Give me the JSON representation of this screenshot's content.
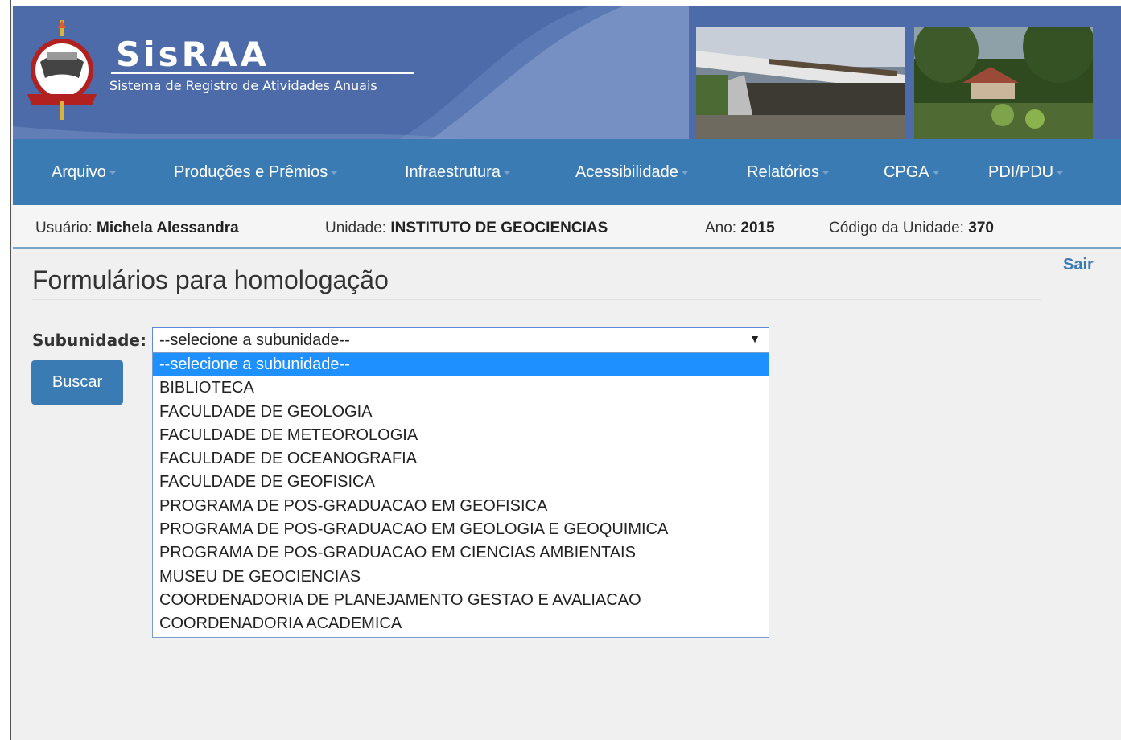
{
  "brand": {
    "title": "SisRAA",
    "subtitle": "Sistema de Registro de Atividades Anuais"
  },
  "nav": [
    {
      "label": "Arquivo"
    },
    {
      "label": "Produções e Prêmios"
    },
    {
      "label": "Infraestrutura"
    },
    {
      "label": "Acessibilidade"
    },
    {
      "label": "Relatórios"
    },
    {
      "label": "CPGA"
    },
    {
      "label": "PDI/PDU"
    }
  ],
  "info": {
    "user_label": "Usuário:",
    "user_value": "Michela Alessandra",
    "unit_label": "Unidade:",
    "unit_value": "INSTITUTO DE GEOCIENCIAS",
    "year_label": "Ano:",
    "year_value": "2015",
    "code_label": "Código da Unidade:",
    "code_value": "370"
  },
  "logout_label": "Sair",
  "page_title": "Formulários para homologação",
  "form": {
    "subunit_label": "Subunidade:",
    "selected_value": "--selecione a subunidade--",
    "search_button": "Buscar",
    "options": [
      "--selecione a subunidade--",
      "BIBLIOTECA",
      "FACULDADE DE GEOLOGIA",
      "FACULDADE DE METEOROLOGIA",
      "FACULDADE DE OCEANOGRAFIA",
      "FACULDADE DE GEOFISICA",
      "PROGRAMA DE POS-GRADUACAO EM GEOFISICA",
      "PROGRAMA DE POS-GRADUACAO EM GEOLOGIA E GEOQUIMICA",
      "PROGRAMA DE POS-GRADUACAO EM CIENCIAS AMBIENTAIS",
      "MUSEU DE GEOCIENCIAS",
      "COORDENADORIA DE PLANEJAMENTO GESTAO E AVALIACAO",
      "COORDENADORIA ACADEMICA"
    ]
  },
  "colors": {
    "header_blue": "#4c6ba8",
    "nav_blue": "#3b7bb3",
    "selected_option": "#1e90ff"
  }
}
